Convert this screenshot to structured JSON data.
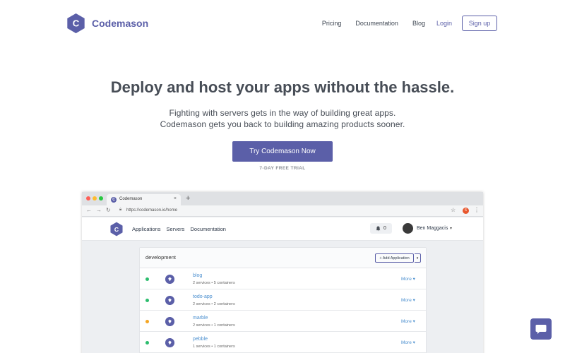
{
  "brand": {
    "name": "Codemason",
    "logo_letter": "C",
    "color": "#5b5fa8"
  },
  "nav": {
    "links": [
      "Pricing",
      "Documentation",
      "Blog"
    ],
    "login": "Login",
    "signup": "Sign up"
  },
  "hero": {
    "title": "Deploy and host your apps without the hassle.",
    "subtitle_line1": "Fighting with servers gets in the way of building great apps.",
    "subtitle_line2": "Codemason gets you back to building amazing products sooner.",
    "cta": "Try Codemason Now",
    "trial": "7-DAY FREE TRIAL"
  },
  "browser": {
    "tab_title": "Codemason",
    "tab_close": "×",
    "new_tab": "+",
    "url": "https://codemason.io/home",
    "extension_badge": "6",
    "app": {
      "logo_letter": "C",
      "links": [
        "Applications",
        "Servers",
        "Documentation"
      ],
      "notifications": "0",
      "user_name": "Ben Maggacis",
      "panel_title": "development",
      "add_button": "+ Add Application",
      "add_caret": "▾",
      "apps": [
        {
          "name": "blog",
          "meta": "2 services • 5 containers",
          "status_color": "#2dbd6e",
          "more": "More ▾"
        },
        {
          "name": "todo-app",
          "meta": "2 services • 2 containers",
          "status_color": "#2dbd6e",
          "more": "More ▾"
        },
        {
          "name": "marble",
          "meta": "2 services • 1 containers",
          "status_color": "#f5a623",
          "more": "More ▾"
        },
        {
          "name": "pebble",
          "meta": "1 services • 1 containers",
          "status_color": "#2dbd6e",
          "more": "More ▾"
        }
      ]
    }
  },
  "chat": {
    "icon": "chat-bubble-icon"
  }
}
